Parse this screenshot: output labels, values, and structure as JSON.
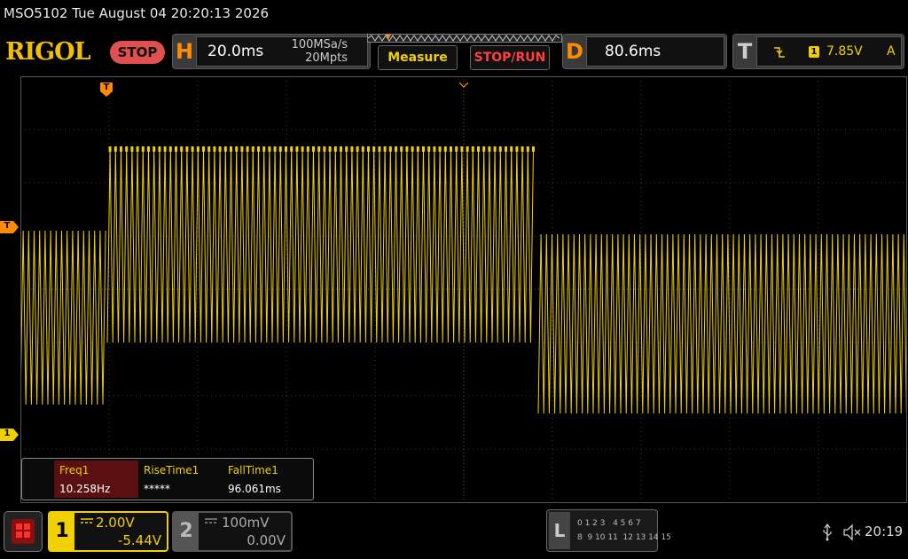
{
  "titlebar": {
    "model_datetime": "MSO5102  Tue August 04 20:20:13 2026"
  },
  "topbar": {
    "logo": "RIGOL",
    "run_state": "STOP",
    "horizontal": {
      "letter": "H",
      "scale": "20.0ms",
      "sample_rate": "100MSa/s",
      "memory_depth": "20Mpts"
    },
    "measure_label": "Measure",
    "stoprun_label": "STOP/RUN",
    "delay": {
      "letter": "D",
      "value": "80.6ms"
    },
    "trigger": {
      "letter": "T",
      "source": "1",
      "level": "7.85V",
      "mode": "A"
    }
  },
  "markers": {
    "trigger_pos": "T",
    "trigger_level": "T",
    "ch1_offset": "1"
  },
  "measurements": [
    {
      "name": "Freq1",
      "value": "10.258Hz",
      "highlight": true
    },
    {
      "name": "RiseTime1",
      "value": "*****",
      "highlight": false
    },
    {
      "name": "FallTime1",
      "value": "96.061ms",
      "highlight": false
    }
  ],
  "channels": {
    "ch1": {
      "number": "1",
      "scale": "2.00V",
      "offset": "-5.44V"
    },
    "ch2": {
      "number": "2",
      "scale": "100mV",
      "offset": "0.00V"
    }
  },
  "la": {
    "letter": "L",
    "row1": "0 1 2 3   4 5 6 7",
    "row2": "8  9 10 11  12 13 14 15"
  },
  "status": {
    "time": "20:19"
  },
  "colors": {
    "ch1": "#f0d000",
    "trigger": "#ff8c00",
    "grid": "#3a3a3a"
  }
}
